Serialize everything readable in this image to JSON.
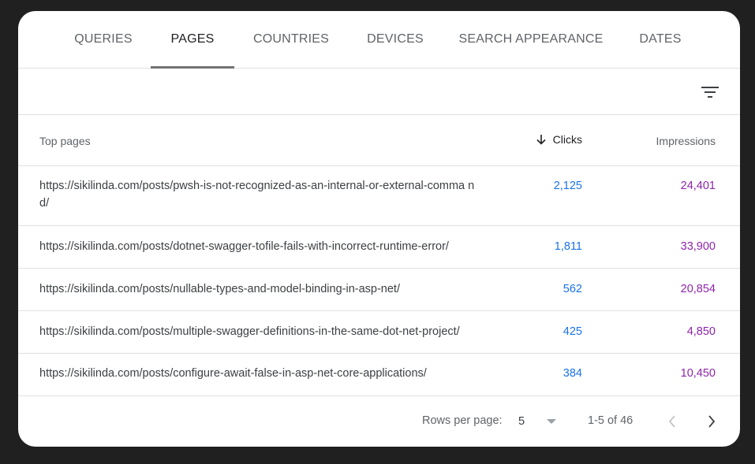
{
  "tabs": [
    {
      "label": "QUERIES",
      "active": false
    },
    {
      "label": "PAGES",
      "active": true
    },
    {
      "label": "COUNTRIES",
      "active": false
    },
    {
      "label": "DEVICES",
      "active": false
    },
    {
      "label": "SEARCH APPEARANCE",
      "active": false
    },
    {
      "label": "DATES",
      "active": false
    }
  ],
  "toolbar": {
    "filter_icon": "filter-icon"
  },
  "table": {
    "columns": {
      "pages": "Top pages",
      "clicks": "Clicks",
      "impressions": "Impressions",
      "sort_icon": "arrow-down-icon"
    },
    "rows": [
      {
        "url": "https://sikilinda.com/posts/pwsh-is-not-recognized-as-an-internal-or-external-comma nd/",
        "clicks": "2,125",
        "impressions": "24,401"
      },
      {
        "url": "https://sikilinda.com/posts/dotnet-swagger-tofile-fails-with-incorrect-runtime-error/",
        "clicks": "1,811",
        "impressions": "33,900"
      },
      {
        "url": "https://sikilinda.com/posts/nullable-types-and-model-binding-in-asp-net/",
        "clicks": "562",
        "impressions": "20,854"
      },
      {
        "url": "https://sikilinda.com/posts/multiple-swagger-definitions-in-the-same-dot-net-project/",
        "clicks": "425",
        "impressions": "4,850"
      },
      {
        "url": "https://sikilinda.com/posts/configure-await-false-in-asp-net-core-applications/",
        "clicks": "384",
        "impressions": "10,450"
      }
    ]
  },
  "pagination": {
    "rows_per_page_label": "Rows per page:",
    "rows_per_page_value": "5",
    "range": "1-5 of 46"
  },
  "colors": {
    "clicks": "#1a73e8",
    "impressions": "#8e24aa",
    "active_tab_indicator": "#737373"
  }
}
